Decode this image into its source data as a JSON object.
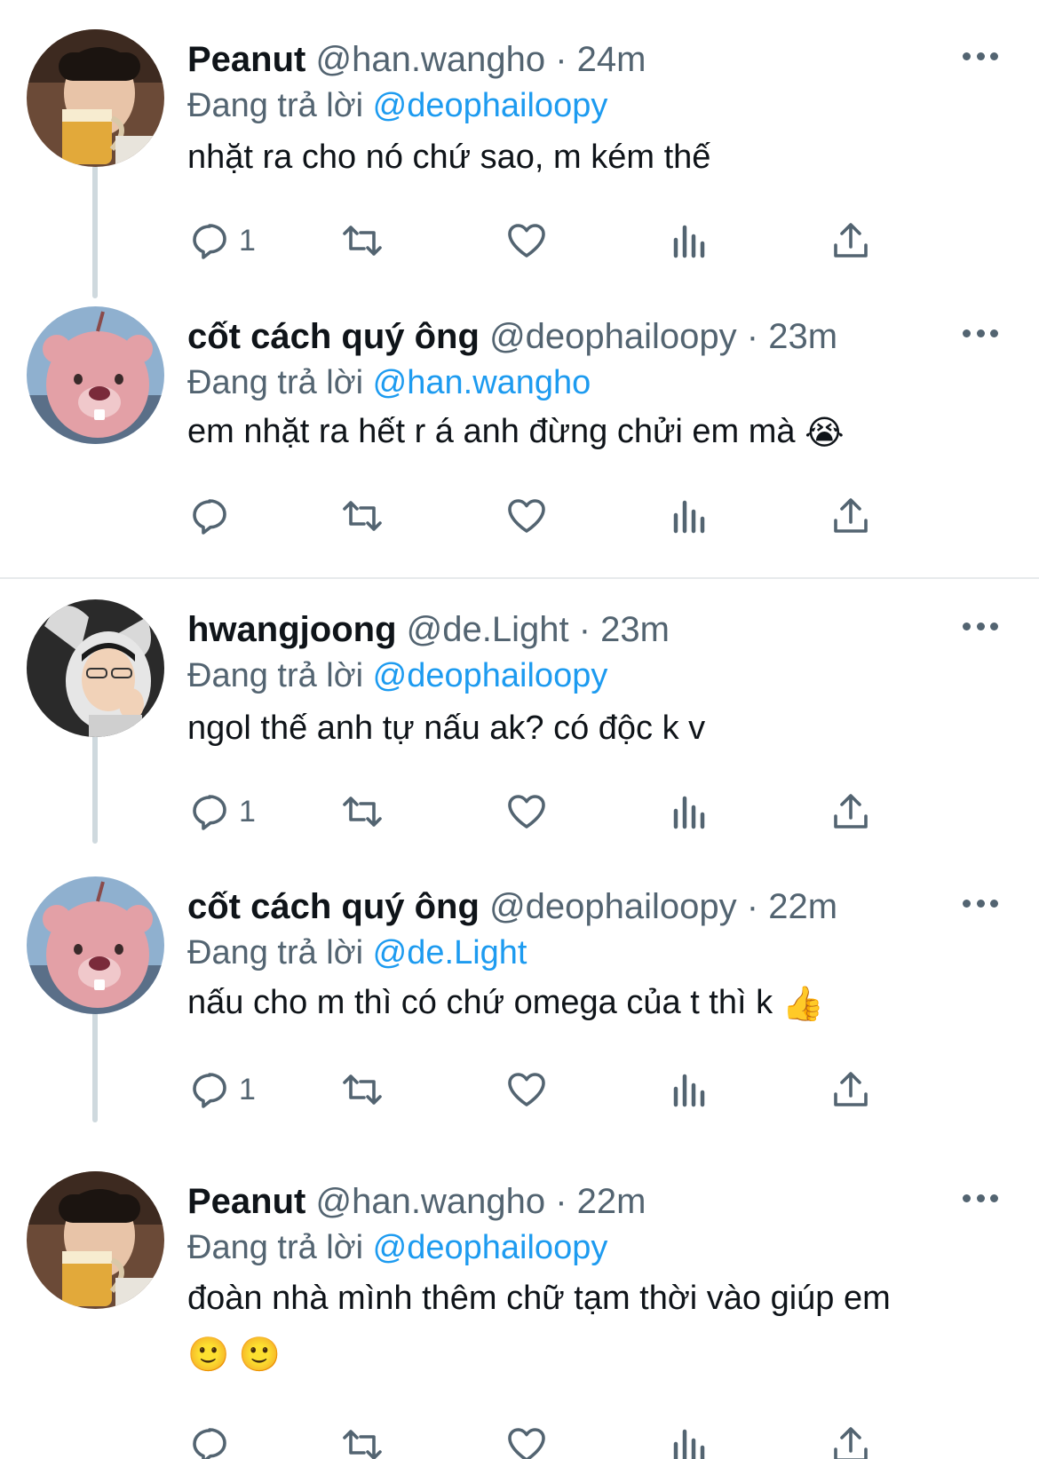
{
  "reply_prefix": "Đang trả lời",
  "tweets": [
    {
      "name": "Peanut",
      "handle": "@han.wangho",
      "time": "24m",
      "replying_to": "@deophailoopy",
      "text": "nhặt ra cho nó chứ sao, m kém thế",
      "emoji": "",
      "text_line2": "",
      "reply_count": "1"
    },
    {
      "name": "cốt cách quý ông",
      "handle": "@deophailoopy",
      "time": "23m",
      "replying_to": "@han.wangho",
      "text": "em nhặt ra hết r á anh đừng chửi em mà",
      "emoji": "😭",
      "text_line2": "",
      "reply_count": ""
    },
    {
      "name": "hwangjoong",
      "handle": "@de.Light",
      "time": "23m",
      "replying_to": "@deophailoopy",
      "text": "ngol thế anh tự nấu ak? có độc k v",
      "emoji": "",
      "text_line2": "",
      "reply_count": "1"
    },
    {
      "name": "cốt cách quý ông",
      "handle": "@deophailoopy",
      "time": "22m",
      "replying_to": "@de.Light",
      "text": "nấu cho m thì có chứ omega của t thì k",
      "emoji": "👍",
      "text_line2": "",
      "reply_count": "1"
    },
    {
      "name": "Peanut",
      "handle": "@han.wangho",
      "time": "22m",
      "replying_to": "@deophailoopy",
      "text": "đoàn nhà mình thêm chữ tạm thời vào giúp em",
      "emoji": "",
      "text_line2": "🙂 🙂",
      "reply_count": ""
    }
  ],
  "colors": {
    "mention": "#1d9bf0",
    "secondary": "#536471",
    "thread_line": "#cfd9de"
  },
  "icons": [
    "reply-icon",
    "retweet-icon",
    "like-icon",
    "views-icon",
    "share-icon",
    "more-icon"
  ]
}
